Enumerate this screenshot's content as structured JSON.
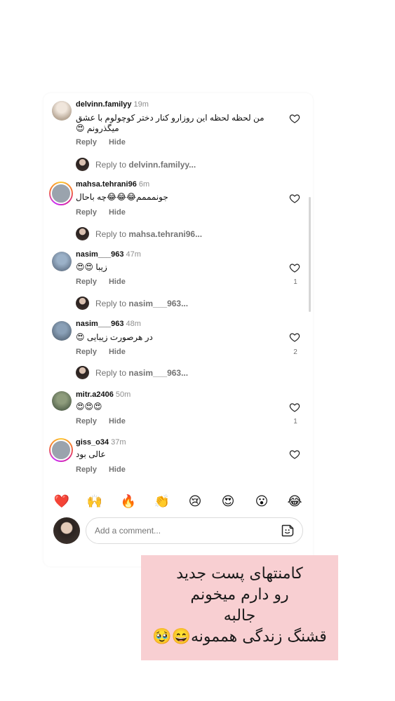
{
  "comments": [
    {
      "username": "delvinn.familyy",
      "time": "19m",
      "text_line1": "من لحظه لحظه این روزارو کنار دختر کوچولوم با عشق",
      "text_line2": "میگذرونم 😍",
      "reply_label": "Reply",
      "hide_label": "Hide",
      "likes": "",
      "view_reply_prefix": "Reply to",
      "view_reply_user": "delvinn.familyy..."
    },
    {
      "username": "mahsa.tehrani96",
      "time": "6m",
      "text_line1": "جونمممم😂😂😂چه باحال",
      "reply_label": "Reply",
      "hide_label": "Hide",
      "likes": "",
      "view_reply_prefix": "Reply to",
      "view_reply_user": "mahsa.tehrani96..."
    },
    {
      "username": "nasim___963",
      "time": "47m",
      "text_line1": "زیبا 😍😍",
      "reply_label": "Reply",
      "hide_label": "Hide",
      "likes": "1",
      "view_reply_prefix": "Reply to",
      "view_reply_user": "nasim___963..."
    },
    {
      "username": "nasim___963",
      "time": "48m",
      "text_line1": "در هرصورت زیبایی 😍",
      "reply_label": "Reply",
      "hide_label": "Hide",
      "likes": "2",
      "view_reply_prefix": "Reply to",
      "view_reply_user": "nasim___963..."
    },
    {
      "username": "mitr.a2406",
      "time": "50m",
      "text_line1": "😍😍😍",
      "reply_label": "Reply",
      "hide_label": "Hide",
      "likes": "1"
    },
    {
      "username": "giss_o34",
      "time": "37m",
      "text_line1": "عالی بود",
      "reply_label": "Reply",
      "hide_label": "Hide",
      "likes": ""
    }
  ],
  "reactions": [
    "❤️",
    "🙌",
    "🔥",
    "👏",
    "😢",
    "😍",
    "😮",
    "😂"
  ],
  "composer": {
    "placeholder": "Add a comment..."
  },
  "icons": {
    "like": "heart-outline-icon",
    "sticker": "sticker-icon"
  },
  "colors": {
    "note_background": "#f8cfd2",
    "secondary_text": "#737373"
  },
  "overlay_note": {
    "line1": "کامنتهای پست جدید",
    "line2": "رو دارم میخونم",
    "line3": "جالبه",
    "line4": "قشنگ زندگی هممونه😄🥹"
  }
}
